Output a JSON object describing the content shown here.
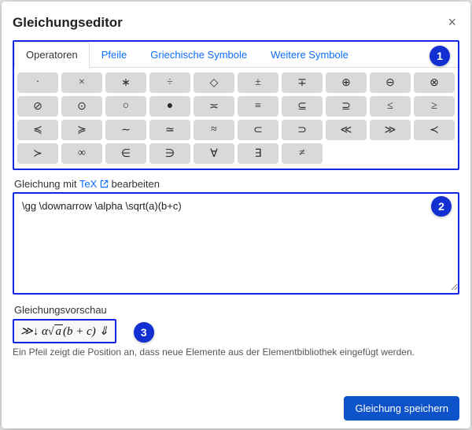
{
  "title": "Gleichungseditor",
  "badges": {
    "one": "1",
    "two": "2",
    "three": "3"
  },
  "tabs": [
    {
      "label": "Operatoren",
      "active": true
    },
    {
      "label": "Pfeile",
      "active": false
    },
    {
      "label": "Griechische Symbole",
      "active": false
    },
    {
      "label": "Weitere Symbole",
      "active": false
    }
  ],
  "symbols": [
    "·",
    "×",
    "∗",
    "÷",
    "◇",
    "±",
    "∓",
    "⊕",
    "⊖",
    "⊗",
    "⊘",
    "⊙",
    "○",
    "●",
    "≍",
    "≡",
    "⊆",
    "⊇",
    "≤",
    "≥",
    "≼",
    "≽",
    "∼",
    "≃",
    "≈",
    "⊂",
    "⊃",
    "≪",
    "≫",
    "≺",
    "≻",
    "∞",
    "∈",
    "∋",
    "∀",
    "∃",
    "≠"
  ],
  "tex_label_prefix": "Gleichung mit ",
  "tex_link": "TeX",
  "tex_label_suffix": " bearbeiten",
  "tex_value": "\\gg \\downarrow \\alpha \\sqrt(a)(b+c)",
  "preview_label": "Gleichungsvorschau",
  "preview_text_pre": "≫↓ α",
  "preview_text_a": "a",
  "preview_text_mid": "(b + c) ⇓",
  "hint": "Ein Pfeil zeigt die Position an, dass neue Elemente aus der Elementbibliothek eingefügt werden.",
  "save_label": "Gleichung speichern"
}
